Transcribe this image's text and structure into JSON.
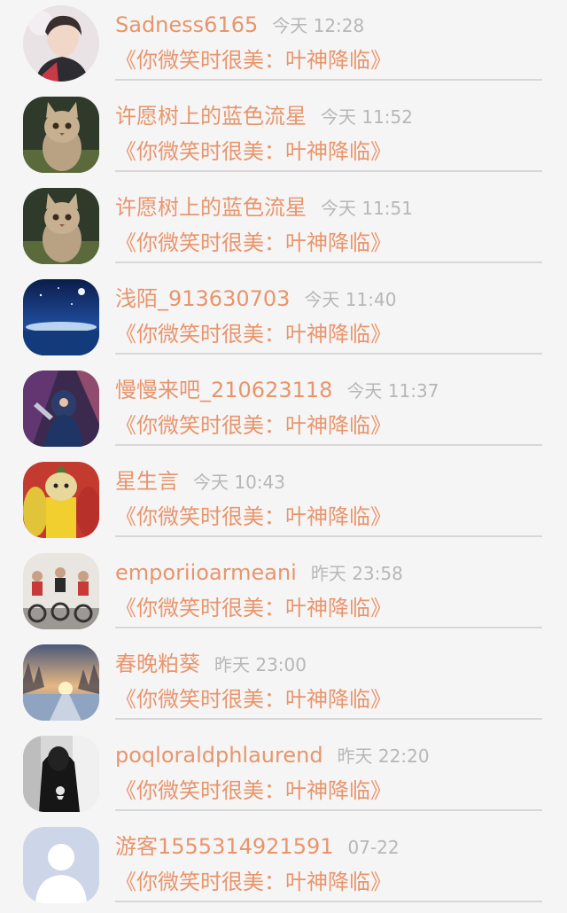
{
  "comments": [
    {
      "avatar": "person-photo-avatar",
      "user": "Sadness6165",
      "time": "今天 12:28",
      "book": "《你微笑时很美：叶神降临》"
    },
    {
      "avatar": "kitten-photo-avatar",
      "user": "许愿树上的蓝色流星",
      "time": "今天 11:52",
      "book": "《你微笑时很美：叶神降临》"
    },
    {
      "avatar": "kitten-photo-avatar",
      "user": "许愿树上的蓝色流星",
      "time": "今天 11:51",
      "book": "《你微笑时很美：叶神降临》"
    },
    {
      "avatar": "night-sky-avatar",
      "user": "浅陌_913630703",
      "time": "今天 11:40",
      "book": "《你微笑时很美：叶神降临》"
    },
    {
      "avatar": "game-character-avatar",
      "user": "慢慢来吧_210623118",
      "time": "今天 11:37",
      "book": "《你微笑时很美：叶神降临》"
    },
    {
      "avatar": "cartoon-figure-avatar",
      "user": "星生言",
      "time": "今天 10:43",
      "book": "《你微笑时很美：叶神降临》"
    },
    {
      "avatar": "cycling-class-avatar",
      "user": "emporiioarmeani",
      "time": "昨天 23:58",
      "book": "《你微笑时很美：叶神降临》"
    },
    {
      "avatar": "sunset-road-avatar",
      "user": "春晚粕葵",
      "time": "昨天 23:00",
      "book": "《你微笑时很美：叶神降临》"
    },
    {
      "avatar": "dark-figure-avatar",
      "user": "poqloraldphlaurend",
      "time": "昨天 22:20",
      "book": "《你微笑时很美：叶神降临》"
    },
    {
      "avatar": "default-user-avatar",
      "user": "游客1555314921591",
      "time": "07-22",
      "book": "《你微笑时很美：叶神降临》"
    }
  ]
}
